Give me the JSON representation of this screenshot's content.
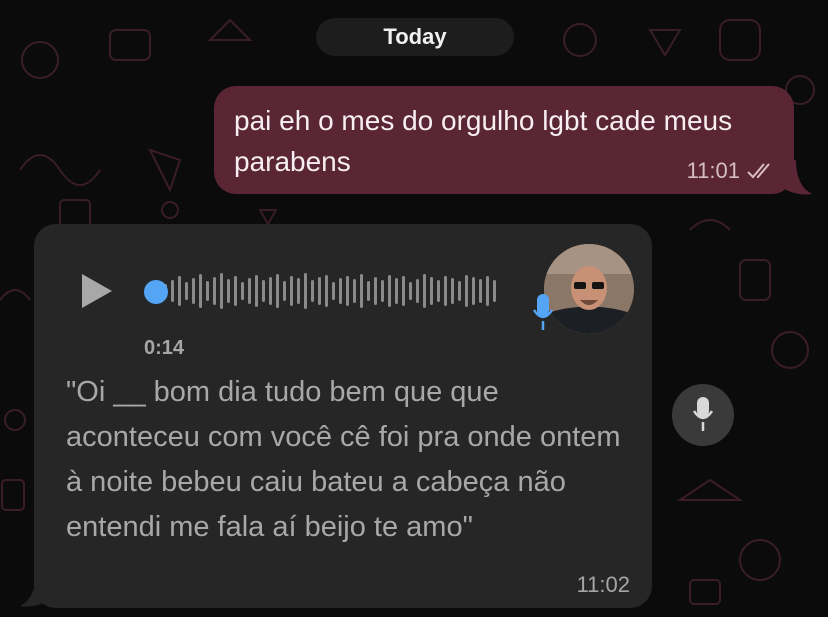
{
  "date_separator": "Today",
  "outgoing": {
    "text": "pai eh o mes do orgulho lgbt cade meus parabens",
    "time": "11:01",
    "status_icon": "double-check-icon"
  },
  "voice_message": {
    "duration": "0:14",
    "progress": 0,
    "transcript": "\"Oi __ bom dia tudo bem que que aconteceu com você cê foi pra onde ontem à noite bebeu caiu bateu a cabeça não entendi me fala aí beijo te amo\"",
    "time": "11:02",
    "play_icon": "play-icon",
    "mic_icon": "microphone-icon"
  },
  "colors": {
    "background": "#0b0b0b",
    "outgoing_bubble": "#5a2534",
    "incoming_bubble": "#262626",
    "accent": "#55a5f7"
  }
}
